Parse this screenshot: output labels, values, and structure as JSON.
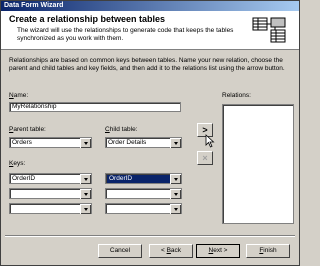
{
  "window": {
    "title": "Data Form Wizard"
  },
  "header": {
    "title": "Create a relationship between tables",
    "subtitle": "The wizard will use the relationships to generate code that keeps the tables synchronized as you work with them."
  },
  "description": "Relationships are based on common keys between tables. Name your new relation, choose the parent and child tables and key fields, and then add it to the relations list using the arrow button.",
  "form": {
    "name_label_key": "N",
    "name_label_rest": "ame:",
    "name_value": "MyRelationship",
    "parent_label_key": "P",
    "parent_label_rest": "arent table:",
    "parent_value": "Orders",
    "child_label_key": "C",
    "child_label_rest": "hild table:",
    "child_value": "Order Details",
    "keys_label_key": "K",
    "keys_label_rest": "eys:",
    "keys": [
      {
        "parent": "OrderID",
        "child": "OrderID"
      },
      {
        "parent": "",
        "child": ""
      },
      {
        "parent": "",
        "child": ""
      }
    ]
  },
  "relations": {
    "label": "Relations:",
    "items": []
  },
  "arrows": {
    "add": ">",
    "remove": "×"
  },
  "buttons": {
    "cancel": "Cancel",
    "back_key": "B",
    "back_pre": "< ",
    "back_rest": "ack",
    "next_key": "N",
    "next_rest": "ext >",
    "finish_key": "F",
    "finish_rest": "inish"
  },
  "colors": {
    "titlebar": "#0a246a",
    "selection": "#0a246a",
    "face": "#d4d0c8"
  }
}
